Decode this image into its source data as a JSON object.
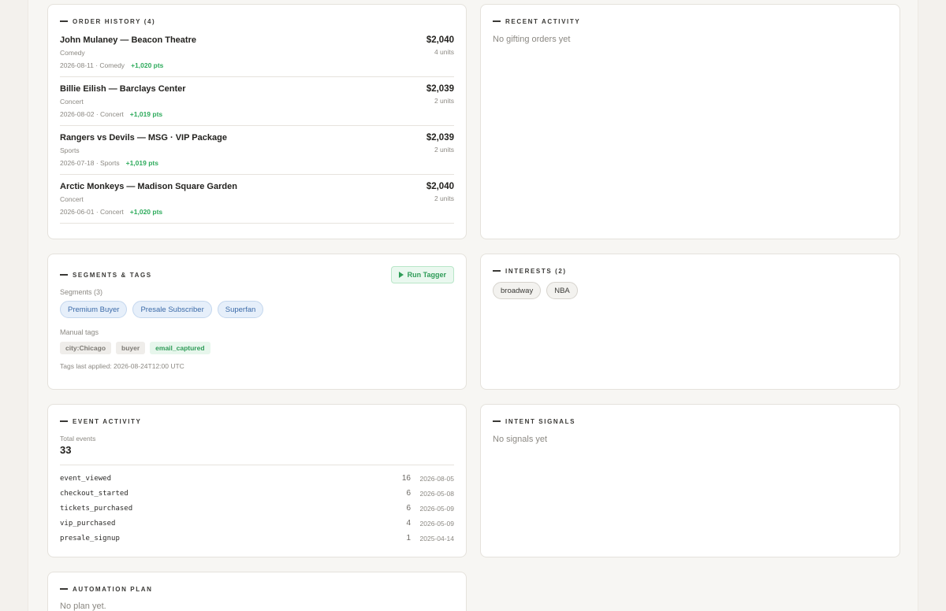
{
  "order_history": {
    "title": "Order History (4)",
    "orders": [
      {
        "title": "John Mulaney — Beacon Theatre",
        "category": "Comedy",
        "meta": "2026-08-11 · Comedy",
        "points": "+1,020 pts",
        "price": "$2,040",
        "units": "4 units"
      },
      {
        "title": "Billie Eilish — Barclays Center",
        "category": "Concert",
        "meta": "2026-08-02 · Concert",
        "points": "+1,019 pts",
        "price": "$2,039",
        "units": "2 units"
      },
      {
        "title": "Rangers vs Devils — MSG · VIP Package",
        "category": "Sports",
        "meta": "2026-07-18 · Sports",
        "points": "+1,019 pts",
        "price": "$2,039",
        "units": "2 units"
      },
      {
        "title": "Arctic Monkeys — Madison Square Garden",
        "category": "Concert",
        "meta": "2026-06-01 · Concert",
        "points": "+1,020 pts",
        "price": "$2,040",
        "units": "2 units"
      }
    ]
  },
  "recent_activity": {
    "title": "Recent Activity",
    "empty": "No gifting orders yet"
  },
  "segments": {
    "title": "Segments & Tags",
    "run_button": "Run Tagger",
    "segments_label": "Segments (3)",
    "segments": [
      "Premium Buyer",
      "Presale Subscriber",
      "Superfan"
    ],
    "manual_label": "Manual tags",
    "tags": [
      "city:Chicago",
      "buyer",
      "email_captured"
    ],
    "last_applied": "Tags last applied: 2026-08-24T12:00 UTC"
  },
  "interests": {
    "title": "Interests (2)",
    "items": [
      "broadway",
      "NBA"
    ]
  },
  "event_activity": {
    "title": "Event Activity",
    "total_label": "Total events",
    "total": "33",
    "events": [
      {
        "name": "event_viewed",
        "count": "16",
        "date": "2026-08-05"
      },
      {
        "name": "checkout_started",
        "count": "6",
        "date": "2026-05-08"
      },
      {
        "name": "tickets_purchased",
        "count": "6",
        "date": "2026-05-09"
      },
      {
        "name": "vip_purchased",
        "count": "4",
        "date": "2026-05-09"
      },
      {
        "name": "presale_signup",
        "count": "1",
        "date": "2025-04-14"
      }
    ]
  },
  "intent_signals": {
    "title": "Intent Signals",
    "empty": "No signals yet"
  },
  "automation_plan": {
    "title": "Automation Plan",
    "empty": "No plan yet."
  },
  "colors": {
    "points_green": "#2eab5c",
    "segment_blue": "#3b6aa8",
    "background": "#f7f6f3"
  }
}
